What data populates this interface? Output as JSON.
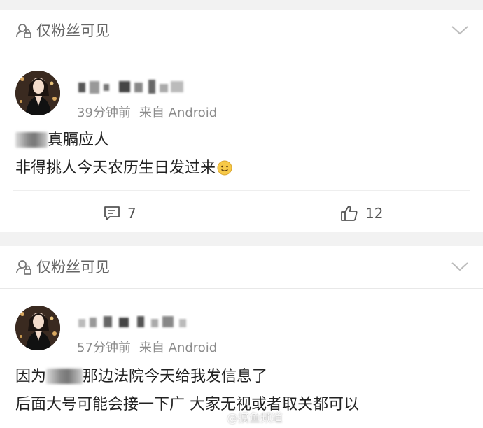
{
  "posts": [
    {
      "visibility": "仅粉丝可见",
      "time": "39分钟前",
      "source": "来自 Android",
      "lines": [
        "真膈应人",
        "非得挑人今天农历生日发过来"
      ],
      "comments": "7",
      "likes": "12"
    },
    {
      "visibility": "仅粉丝可见",
      "time": "57分钟前",
      "source": "来自 Android",
      "lines": [
        "因为",
        "那边法院今天给我发信息了",
        "后面大号可能会接一下广 大家无视或者取关都可以"
      ]
    }
  ],
  "watermark": "@摸鱼频道",
  "colors": {
    "background": "#f2f2f2",
    "card": "#ffffff",
    "meta_text": "#8c8c8c",
    "icon": "#555555"
  }
}
